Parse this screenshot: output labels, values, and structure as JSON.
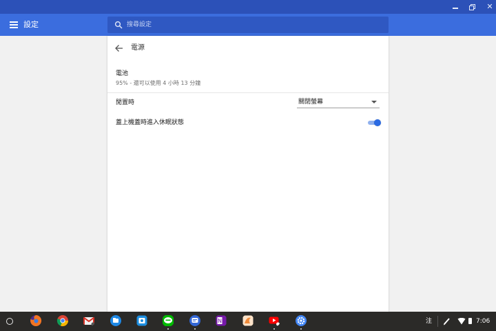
{
  "window": {
    "controls": {
      "minimize": "minimize-icon",
      "restore": "restore-icon",
      "close": "✕"
    }
  },
  "header": {
    "title": "設定",
    "menu_icon": "menu-icon",
    "search": {
      "placeholder": "搜尋設定",
      "value": ""
    }
  },
  "page": {
    "title": "電源",
    "battery": {
      "title": "電池",
      "status": "95% - 還可以使用 4 小時 13 分鐘"
    },
    "idle": {
      "label": "閒置時",
      "selected": "關閉螢幕"
    },
    "lid": {
      "label": "蓋上機蓋時進入休眠狀態",
      "enabled": true
    }
  },
  "shelf": {
    "apps": [
      {
        "name": "firefox-icon",
        "running": false
      },
      {
        "name": "chrome-icon",
        "running": false
      },
      {
        "name": "gmail-icon",
        "running": false
      },
      {
        "name": "files-icon",
        "running": false
      },
      {
        "name": "file-manager-icon",
        "running": false
      },
      {
        "name": "line-icon",
        "running": true
      },
      {
        "name": "messages-icon",
        "running": true
      },
      {
        "name": "onenote-icon",
        "running": false
      },
      {
        "name": "photo-editor-icon",
        "running": false
      },
      {
        "name": "youtube-icon",
        "running": true
      },
      {
        "name": "settings-icon",
        "running": true
      }
    ],
    "ime": "注",
    "time": "7:06"
  },
  "colors": {
    "titlebar": "#2c51b8",
    "appbar": "#3b6dde",
    "search": "#2f58c2",
    "accent": "#2a6ae3",
    "shelf": "#2b2a28"
  }
}
